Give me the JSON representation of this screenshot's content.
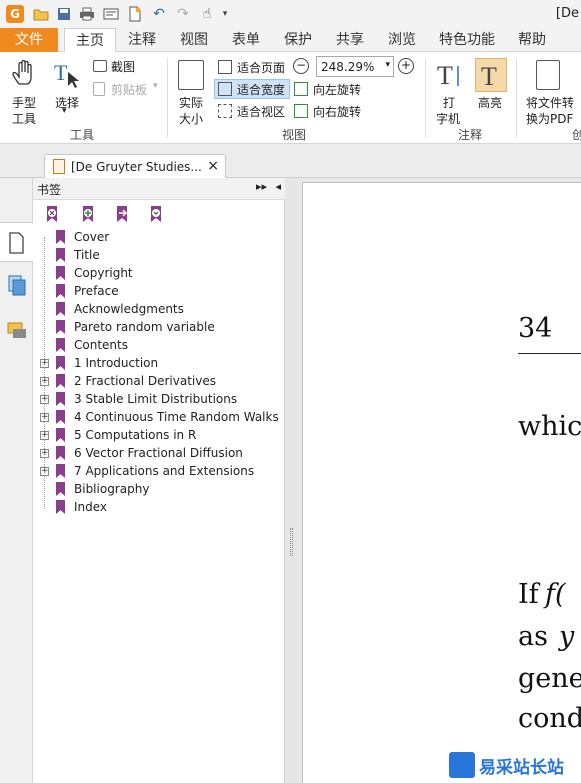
{
  "title_bar": {
    "title": "[De"
  },
  "menu": {
    "items": [
      "文件",
      "主页",
      "注释",
      "视图",
      "表单",
      "保护",
      "共享",
      "浏览",
      "特色功能",
      "帮助"
    ],
    "active": "主页"
  },
  "ribbon": {
    "hand_tool": "手型\n工具",
    "hand_line1": "手型",
    "hand_line2": "工具",
    "select": "选择",
    "screenshot": "截图",
    "clipboard": "剪贴板",
    "group_tools": "工具",
    "actual_size_line1": "实际",
    "actual_size_line2": "大小",
    "fit_page": "适合页面",
    "fit_width": "适合宽度",
    "fit_visible": "适合视区",
    "zoom_value": "248.29%",
    "rotate_left": "向左旋转",
    "rotate_right": "向右旋转",
    "group_view": "视图",
    "typewriter_line1": "打",
    "typewriter_line2": "字机",
    "highlight": "高亮",
    "group_comment": "注释",
    "to_pdf_line1": "将文件转",
    "to_pdf_line2": "换为PDF",
    "group_create": "创"
  },
  "doc_tab": {
    "label": "[De Gruyter Studies...",
    "close": "×"
  },
  "bookmarks": {
    "header": "书签",
    "items": [
      {
        "label": "Cover",
        "expandable": false
      },
      {
        "label": "Title",
        "expandable": false
      },
      {
        "label": "Copyright",
        "expandable": false
      },
      {
        "label": "Preface",
        "expandable": false
      },
      {
        "label": "Acknowledgments",
        "expandable": false
      },
      {
        "label": "Pareto random variable",
        "expandable": false
      },
      {
        "label": "Contents",
        "expandable": false
      },
      {
        "label": "1 Introduction",
        "expandable": true
      },
      {
        "label": "2 Fractional Derivatives",
        "expandable": true
      },
      {
        "label": "3 Stable Limit Distributions",
        "expandable": true
      },
      {
        "label": "4 Continuous Time Random Walks",
        "expandable": true
      },
      {
        "label": "5 Computations in R",
        "expandable": true
      },
      {
        "label": "6 Vector Fractional Diffusion",
        "expandable": true
      },
      {
        "label": "7 Applications and Extensions",
        "expandable": true
      },
      {
        "label": "Bibliography",
        "expandable": false
      },
      {
        "label": "Index",
        "expandable": false
      }
    ]
  },
  "document": {
    "page_number": "34",
    "line1": "which",
    "line2a": "If",
    "line2b": "f(",
    "line3a": "as",
    "line3b": "y",
    "line4": "gener",
    "line5": "cond"
  },
  "watermark": {
    "text": "易采站长站"
  },
  "colors": {
    "accent": "#f08a1e",
    "bookmark": "#8a3f8c",
    "highlight_btn": "#f5d9a8"
  }
}
